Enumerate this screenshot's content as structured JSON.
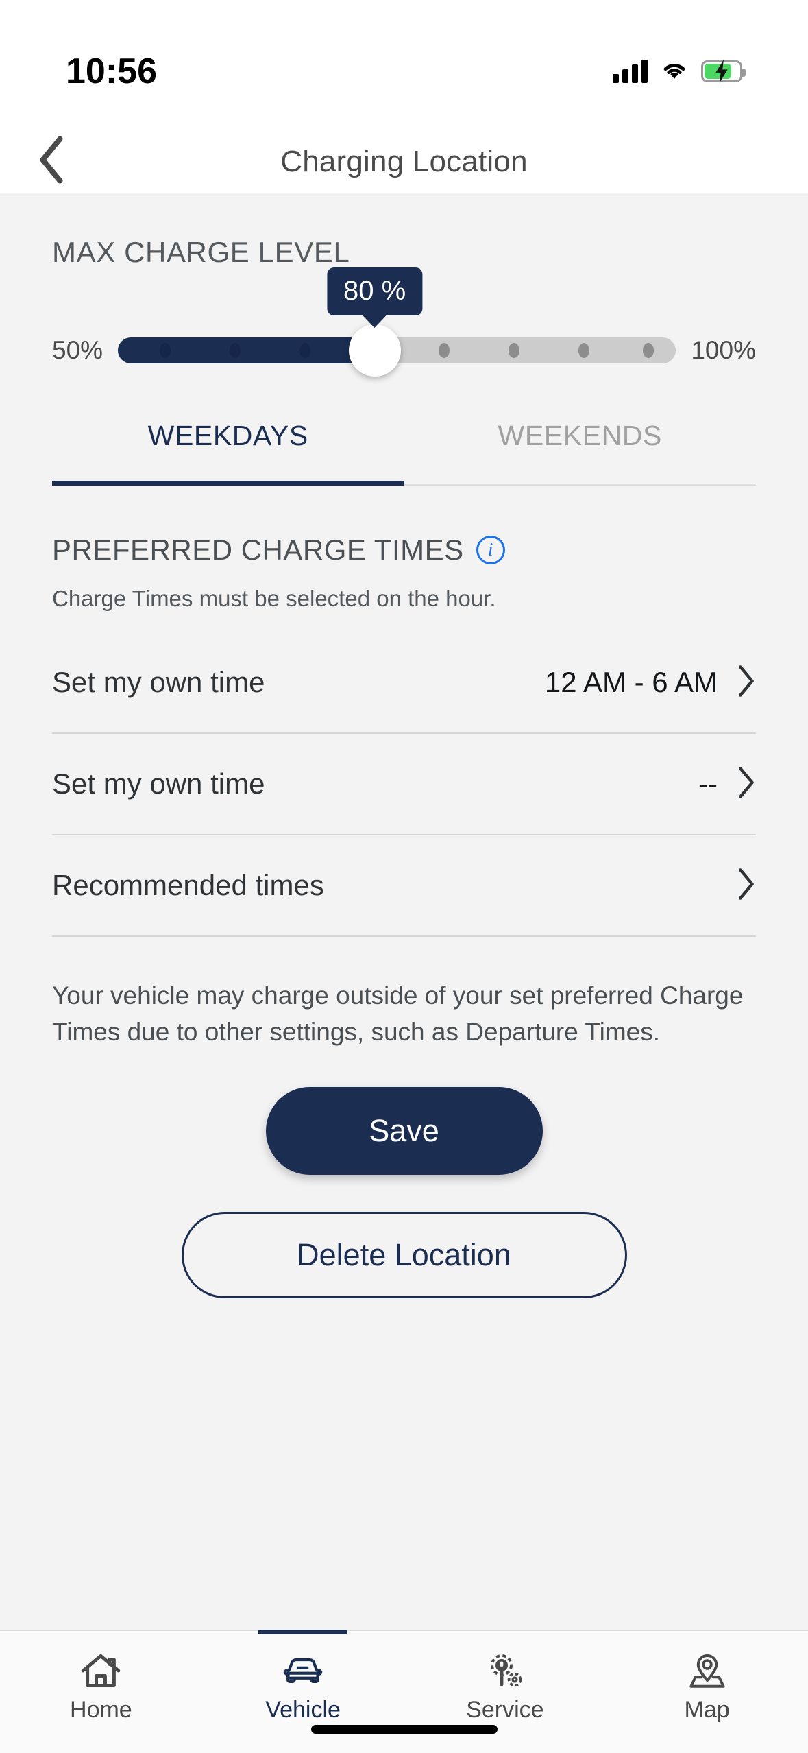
{
  "status_bar": {
    "time": "10:56",
    "signal_icon": "cellular-signal-icon",
    "wifi_icon": "wifi-icon",
    "battery_icon": "battery-charging-icon",
    "battery_level_percent": 78
  },
  "header": {
    "back_icon": "back-chevron-icon",
    "title": "Charging Location"
  },
  "max_charge": {
    "section_label": "MAX CHARGE LEVEL",
    "tooltip_value": "80 %",
    "value_percent": 80,
    "min_label": "50%",
    "max_label": "100%",
    "min": 50,
    "max": 100,
    "filled_color": "#1b2e52",
    "track_color": "#cccccc"
  },
  "tabs": [
    {
      "label": "WEEKDAYS",
      "active": true
    },
    {
      "label": "WEEKENDS",
      "active": false
    }
  ],
  "preferred_charge_times": {
    "title": "PREFERRED CHARGE TIMES",
    "info_icon": "info-circle-icon",
    "subtitle": "Charge Times must be selected on the hour.",
    "rows": [
      {
        "label": "Set my own time",
        "value": "12 AM - 6 AM",
        "chevron": "chevron-right-icon"
      },
      {
        "label": "Set my own time",
        "value": "--",
        "chevron": "chevron-right-icon"
      },
      {
        "label": "Recommended times",
        "value": "",
        "chevron": "chevron-right-icon"
      }
    ]
  },
  "disclaimer": "Your vehicle may charge outside of your set preferred Charge Times due to other settings, such as Departure Times.",
  "actions": {
    "save_label": "Save",
    "delete_label": "Delete Location"
  },
  "bottom_nav": [
    {
      "label": "Home",
      "icon": "home-icon",
      "active": false
    },
    {
      "label": "Vehicle",
      "icon": "car-icon",
      "active": true
    },
    {
      "label": "Service",
      "icon": "gear-wrench-icon",
      "active": false
    },
    {
      "label": "Map",
      "icon": "map-pin-icon",
      "active": false
    }
  ],
  "colors": {
    "brand_navy": "#1b2e52",
    "accent_blue": "#1a73e8",
    "battery_green": "#4cd662",
    "page_background": "#f3f3f3"
  }
}
